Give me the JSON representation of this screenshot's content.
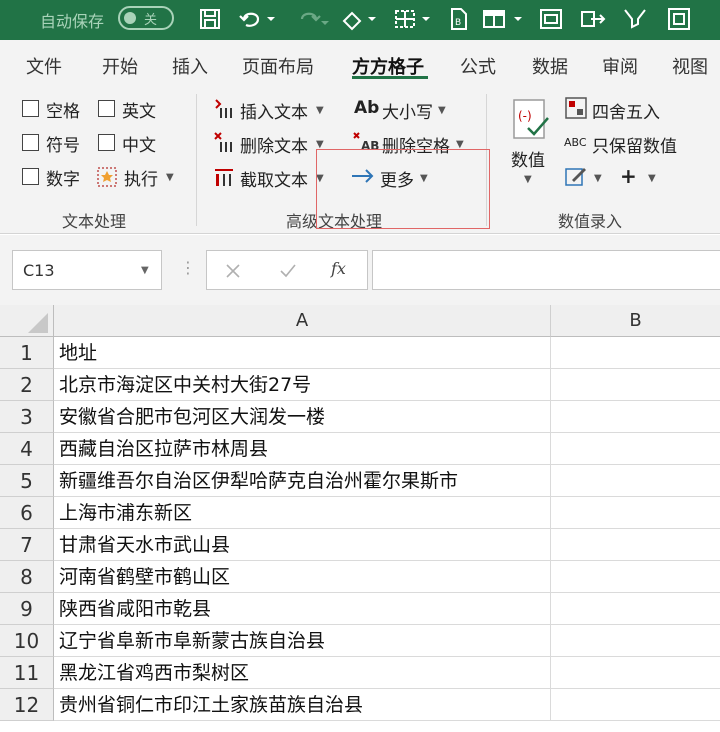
{
  "title_bar": {
    "autosave_label": "自动保存",
    "toggle_state": "关"
  },
  "tabs": [
    "文件",
    "开始",
    "插入",
    "页面布局",
    "方方格子",
    "公式",
    "数据",
    "审阅",
    "视图"
  ],
  "active_tab": "方方格子",
  "ribbon": {
    "text_group": {
      "label": "文本处理",
      "checkboxes": [
        "空格",
        "英文",
        "符号",
        "中文",
        "数字"
      ],
      "execute_label": "执行"
    },
    "advanced_group": {
      "label": "高级文本处理",
      "insert_text": "插入文本",
      "delete_text": "删除文本",
      "extract_text": "截取文本",
      "case_label": "大小写",
      "delete_spaces": "删除空格",
      "more_label": "更多"
    },
    "number_group": {
      "label": "数值录入",
      "value_label": "数值",
      "round_label": "四舍五入",
      "keep_values": "只保留数值"
    }
  },
  "formula_bar": {
    "cell_ref": "C13",
    "fx_label": "fx",
    "value": ""
  },
  "grid": {
    "columns": [
      "A",
      "B"
    ],
    "rows": [
      {
        "num": "1",
        "a": "地址",
        "b": ""
      },
      {
        "num": "2",
        "a": "北京市海淀区中关村大街27号",
        "b": ""
      },
      {
        "num": "3",
        "a": "安徽省合肥市包河区大润发一楼",
        "b": ""
      },
      {
        "num": "4",
        "a": "西藏自治区拉萨市林周县",
        "b": ""
      },
      {
        "num": "5",
        "a": "新疆维吾尔自治区伊犁哈萨克自治州霍尔果斯市",
        "b": ""
      },
      {
        "num": "6",
        "a": "上海市浦东新区",
        "b": ""
      },
      {
        "num": "7",
        "a": "甘肃省天水市武山县",
        "b": ""
      },
      {
        "num": "8",
        "a": "河南省鹤壁市鹤山区",
        "b": ""
      },
      {
        "num": "9",
        "a": "陕西省咸阳市乾县",
        "b": ""
      },
      {
        "num": "10",
        "a": "辽宁省阜新市阜新蒙古族自治县",
        "b": ""
      },
      {
        "num": "11",
        "a": "黑龙江省鸡西市梨树区",
        "b": ""
      },
      {
        "num": "12",
        "a": "贵州省铜仁市印江土家族苗族自治县",
        "b": ""
      }
    ]
  }
}
